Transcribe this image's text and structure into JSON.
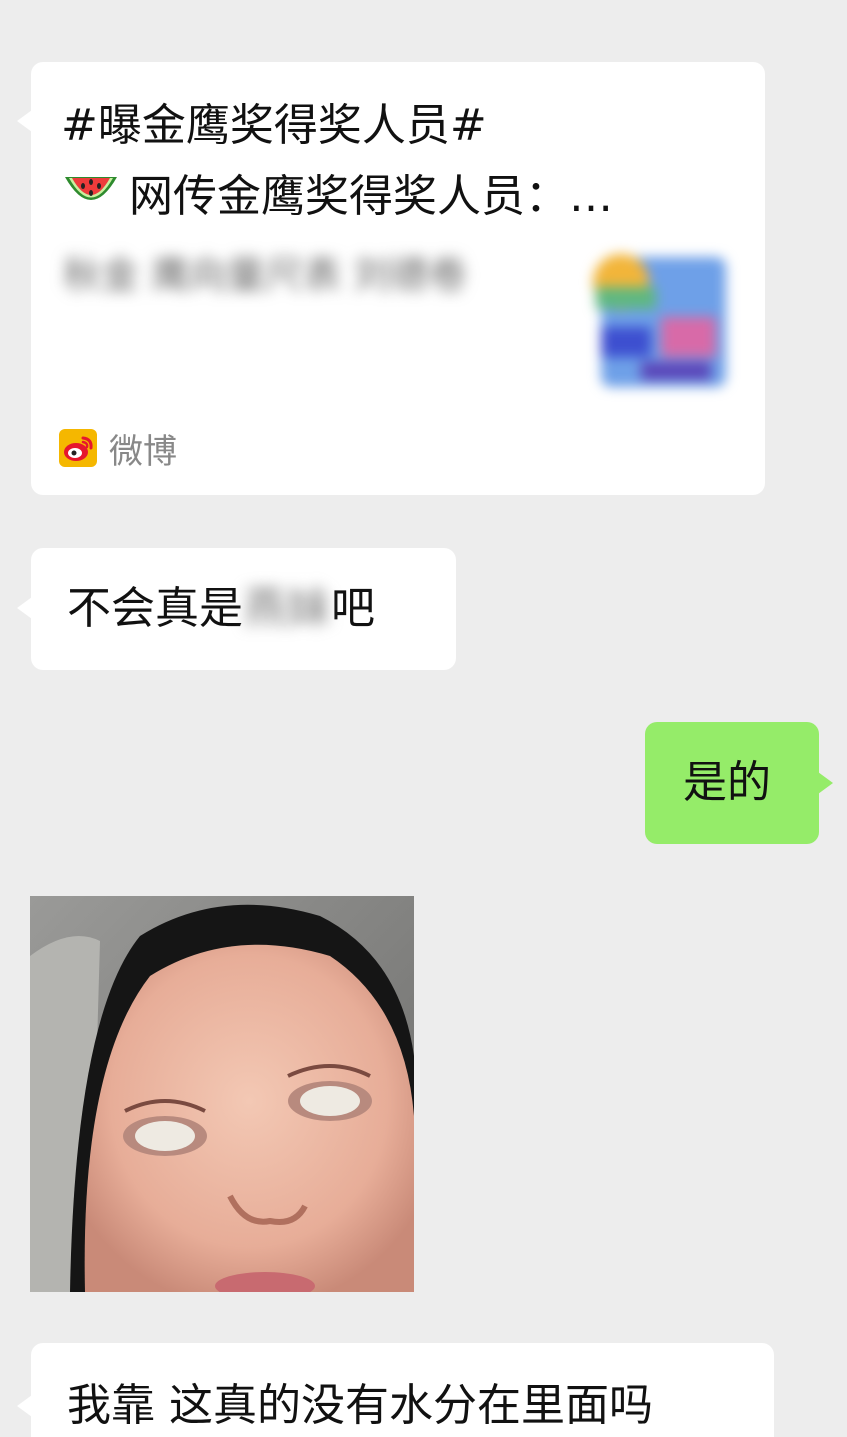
{
  "chat": {
    "link_card": {
      "title_line1": "#曝金鹰奖得奖人员#",
      "title_line2": "网传金鹰奖得奖人员：…",
      "emoji_icon": "watermelon-icon",
      "description": "秋金 鹰向量尺表 刘德卷",
      "source_icon": "weibo-icon",
      "source": "微博"
    },
    "messages": [
      {
        "side": "left",
        "parts": {
          "before": "不会真是",
          "hidden": "燕妹",
          "after": "吧"
        }
      },
      {
        "side": "right",
        "text": "是的"
      },
      {
        "side": "left",
        "type": "image",
        "image": "child-eyeroll-meme"
      },
      {
        "side": "left",
        "text": "我靠 这真的没有水分在里面吗"
      }
    ]
  },
  "colors": {
    "background": "#ededed",
    "incoming_bubble": "#ffffff",
    "outgoing_bubble": "#95ec69"
  }
}
